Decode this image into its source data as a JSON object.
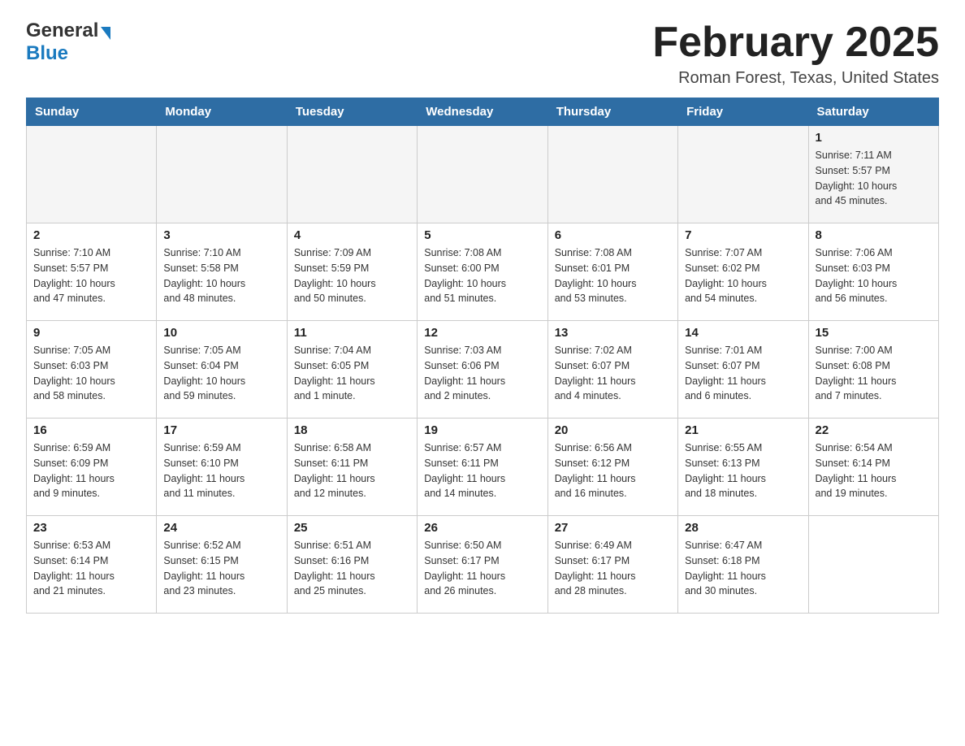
{
  "header": {
    "logo": {
      "general": "General",
      "blue": "Blue",
      "tagline": ""
    },
    "title": "February 2025",
    "location": "Roman Forest, Texas, United States"
  },
  "calendar": {
    "days_of_week": [
      "Sunday",
      "Monday",
      "Tuesday",
      "Wednesday",
      "Thursday",
      "Friday",
      "Saturday"
    ],
    "weeks": [
      [
        {
          "day": "",
          "info": ""
        },
        {
          "day": "",
          "info": ""
        },
        {
          "day": "",
          "info": ""
        },
        {
          "day": "",
          "info": ""
        },
        {
          "day": "",
          "info": ""
        },
        {
          "day": "",
          "info": ""
        },
        {
          "day": "1",
          "info": "Sunrise: 7:11 AM\nSunset: 5:57 PM\nDaylight: 10 hours\nand 45 minutes."
        }
      ],
      [
        {
          "day": "2",
          "info": "Sunrise: 7:10 AM\nSunset: 5:57 PM\nDaylight: 10 hours\nand 47 minutes."
        },
        {
          "day": "3",
          "info": "Sunrise: 7:10 AM\nSunset: 5:58 PM\nDaylight: 10 hours\nand 48 minutes."
        },
        {
          "day": "4",
          "info": "Sunrise: 7:09 AM\nSunset: 5:59 PM\nDaylight: 10 hours\nand 50 minutes."
        },
        {
          "day": "5",
          "info": "Sunrise: 7:08 AM\nSunset: 6:00 PM\nDaylight: 10 hours\nand 51 minutes."
        },
        {
          "day": "6",
          "info": "Sunrise: 7:08 AM\nSunset: 6:01 PM\nDaylight: 10 hours\nand 53 minutes."
        },
        {
          "day": "7",
          "info": "Sunrise: 7:07 AM\nSunset: 6:02 PM\nDaylight: 10 hours\nand 54 minutes."
        },
        {
          "day": "8",
          "info": "Sunrise: 7:06 AM\nSunset: 6:03 PM\nDaylight: 10 hours\nand 56 minutes."
        }
      ],
      [
        {
          "day": "9",
          "info": "Sunrise: 7:05 AM\nSunset: 6:03 PM\nDaylight: 10 hours\nand 58 minutes."
        },
        {
          "day": "10",
          "info": "Sunrise: 7:05 AM\nSunset: 6:04 PM\nDaylight: 10 hours\nand 59 minutes."
        },
        {
          "day": "11",
          "info": "Sunrise: 7:04 AM\nSunset: 6:05 PM\nDaylight: 11 hours\nand 1 minute."
        },
        {
          "day": "12",
          "info": "Sunrise: 7:03 AM\nSunset: 6:06 PM\nDaylight: 11 hours\nand 2 minutes."
        },
        {
          "day": "13",
          "info": "Sunrise: 7:02 AM\nSunset: 6:07 PM\nDaylight: 11 hours\nand 4 minutes."
        },
        {
          "day": "14",
          "info": "Sunrise: 7:01 AM\nSunset: 6:07 PM\nDaylight: 11 hours\nand 6 minutes."
        },
        {
          "day": "15",
          "info": "Sunrise: 7:00 AM\nSunset: 6:08 PM\nDaylight: 11 hours\nand 7 minutes."
        }
      ],
      [
        {
          "day": "16",
          "info": "Sunrise: 6:59 AM\nSunset: 6:09 PM\nDaylight: 11 hours\nand 9 minutes."
        },
        {
          "day": "17",
          "info": "Sunrise: 6:59 AM\nSunset: 6:10 PM\nDaylight: 11 hours\nand 11 minutes."
        },
        {
          "day": "18",
          "info": "Sunrise: 6:58 AM\nSunset: 6:11 PM\nDaylight: 11 hours\nand 12 minutes."
        },
        {
          "day": "19",
          "info": "Sunrise: 6:57 AM\nSunset: 6:11 PM\nDaylight: 11 hours\nand 14 minutes."
        },
        {
          "day": "20",
          "info": "Sunrise: 6:56 AM\nSunset: 6:12 PM\nDaylight: 11 hours\nand 16 minutes."
        },
        {
          "day": "21",
          "info": "Sunrise: 6:55 AM\nSunset: 6:13 PM\nDaylight: 11 hours\nand 18 minutes."
        },
        {
          "day": "22",
          "info": "Sunrise: 6:54 AM\nSunset: 6:14 PM\nDaylight: 11 hours\nand 19 minutes."
        }
      ],
      [
        {
          "day": "23",
          "info": "Sunrise: 6:53 AM\nSunset: 6:14 PM\nDaylight: 11 hours\nand 21 minutes."
        },
        {
          "day": "24",
          "info": "Sunrise: 6:52 AM\nSunset: 6:15 PM\nDaylight: 11 hours\nand 23 minutes."
        },
        {
          "day": "25",
          "info": "Sunrise: 6:51 AM\nSunset: 6:16 PM\nDaylight: 11 hours\nand 25 minutes."
        },
        {
          "day": "26",
          "info": "Sunrise: 6:50 AM\nSunset: 6:17 PM\nDaylight: 11 hours\nand 26 minutes."
        },
        {
          "day": "27",
          "info": "Sunrise: 6:49 AM\nSunset: 6:17 PM\nDaylight: 11 hours\nand 28 minutes."
        },
        {
          "day": "28",
          "info": "Sunrise: 6:47 AM\nSunset: 6:18 PM\nDaylight: 11 hours\nand 30 minutes."
        },
        {
          "day": "",
          "info": ""
        }
      ]
    ]
  }
}
